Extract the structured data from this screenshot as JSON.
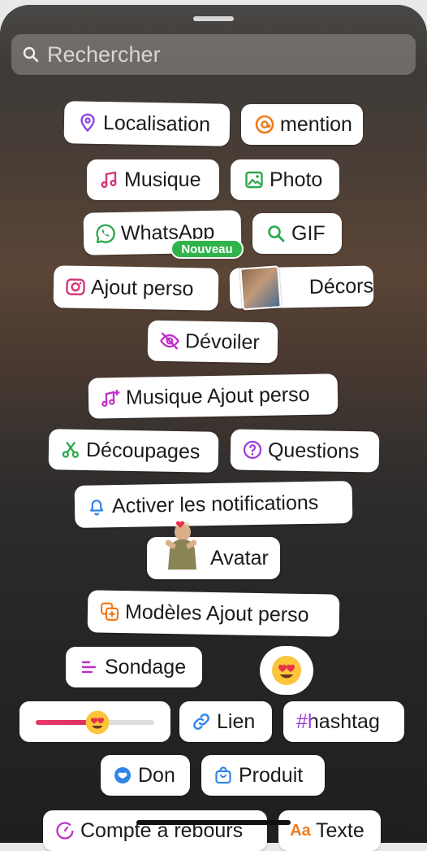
{
  "search": {
    "placeholder": "Rechercher"
  },
  "stickers": {
    "localisation": "Localisation",
    "mention": "mention",
    "musique": "Musique",
    "photo": "Photo",
    "whatsapp": "WhatsApp",
    "whatsapp_badge": "Nouveau",
    "gif": "GIF",
    "ajout_perso": "Ajout perso",
    "decors": "Décors",
    "devoiler": "Dévoiler",
    "musique_ajout_perso": "Musique Ajout perso",
    "decoupages": "Découpages",
    "questions": "Questions",
    "activer_notifications": "Activer les notifications",
    "avatar": "Avatar",
    "modeles_ajout_perso": "Modèles Ajout perso",
    "sondage": "Sondage",
    "emoji_slider_value": 0.52,
    "lien": "Lien",
    "hashtag": "#hashtag",
    "don": "Don",
    "produit": "Produit",
    "compte_a_rebours": "Compte à rebours",
    "texte": "Texte"
  },
  "colors": {
    "purple": "#9b3fd6",
    "orange": "#f07a1a",
    "pink": "#d2367a",
    "green": "#2aa84a",
    "blue": "#2f86e8"
  }
}
